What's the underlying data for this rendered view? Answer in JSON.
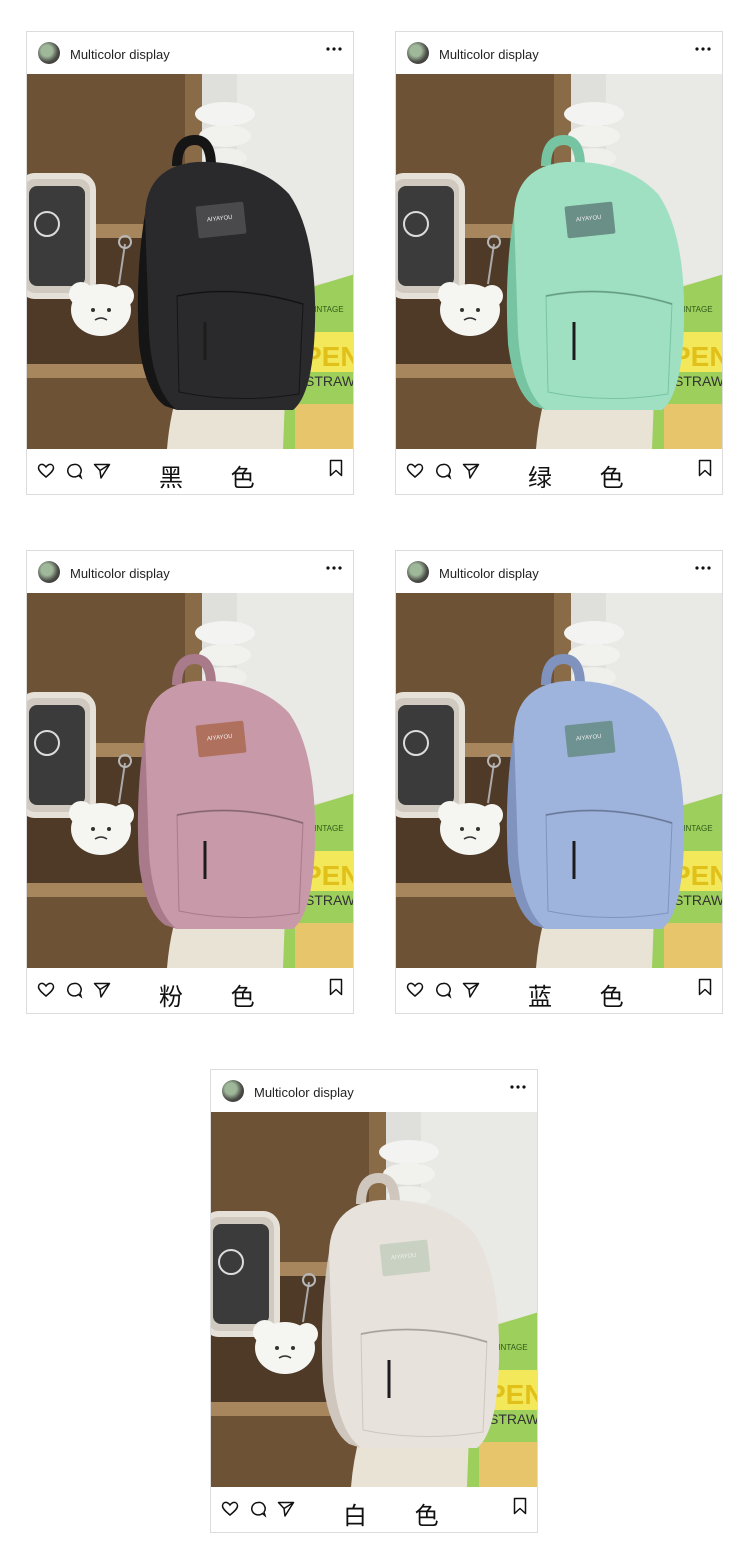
{
  "cards": [
    {
      "username": "Multicolor display",
      "caption": "黑 色",
      "bag_color": "#2a2a2c",
      "bag_shade": "#151516",
      "patch_color": "#4a4a4c",
      "patch_text": "AIYAYOU"
    },
    {
      "username": "Multicolor display",
      "caption": "绿 色",
      "bag_color": "#9fe0c2",
      "bag_shade": "#77c4a3",
      "patch_color": "#6a8f86",
      "patch_text": "AIYAYOU"
    },
    {
      "username": "Multicolor display",
      "caption": "粉 色",
      "bag_color": "#c89aa9",
      "bag_shade": "#a87a8a",
      "patch_color": "#b0705e",
      "patch_text": "AIYAYOU"
    },
    {
      "username": "Multicolor display",
      "caption": "蓝 色",
      "bag_color": "#9fb4dc",
      "bag_shade": "#7f93be",
      "patch_color": "#6e9191",
      "patch_text": "AIYAYOU"
    },
    {
      "username": "Multicolor display",
      "caption": "白 色",
      "bag_color": "#e8e2dc",
      "bag_shade": "#cfc7be",
      "patch_color": "#c9d2c2",
      "patch_text": "AIYAYOU"
    }
  ],
  "props": {
    "snack_bag_text": "PEN",
    "snack_bag_subtext": "STRAW",
    "snack_bag_tag": "VINTAGE"
  }
}
